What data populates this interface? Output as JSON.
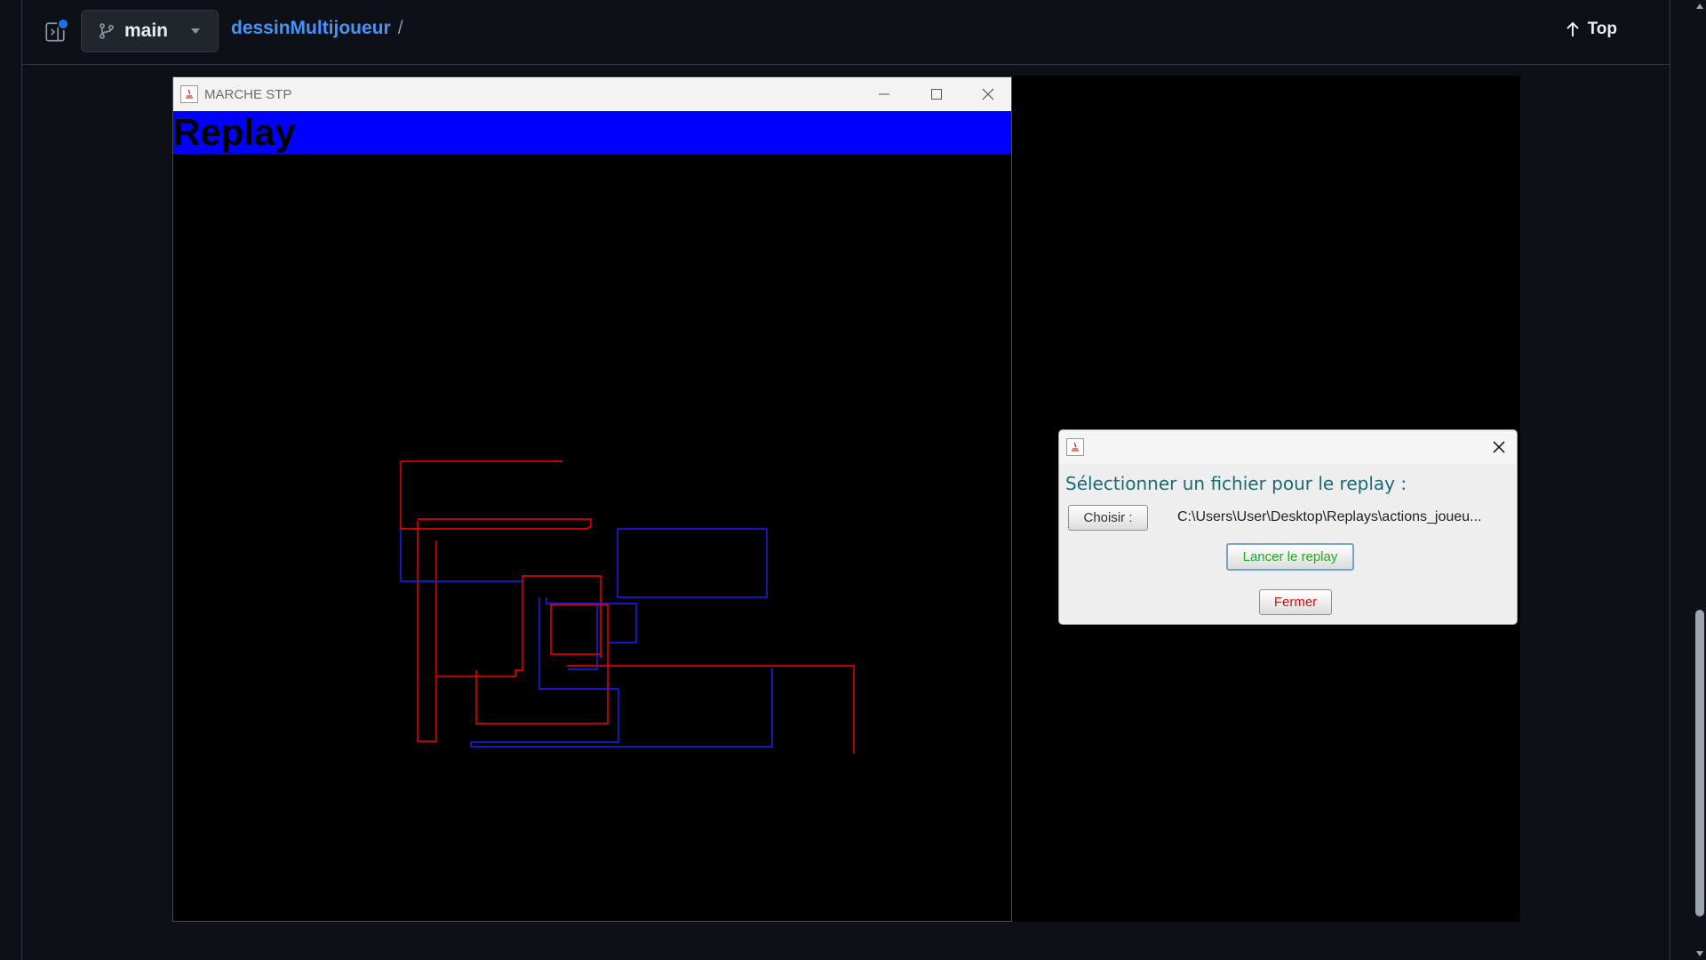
{
  "github": {
    "branch": "main",
    "repo": "dessinMultijoueur",
    "separator": "/",
    "top_label": "Top"
  },
  "app_window": {
    "title": "MARCHE STP",
    "heading": "Replay",
    "heading_bg": "#0000ff"
  },
  "drawing": {
    "colors": {
      "red": "#ff0000",
      "blue": "#2020ff"
    }
  },
  "dialog": {
    "prompt": "Sélectionner un fichier pour le replay :",
    "choose_label": "Choisir :",
    "file_path": "C:\\Users\\User\\Desktop\\Replays\\actions_joueu...",
    "launch_label": "Lancer le replay",
    "close_label": "Fermer",
    "launch_color": "#22aa22",
    "close_color": "#e01010"
  }
}
